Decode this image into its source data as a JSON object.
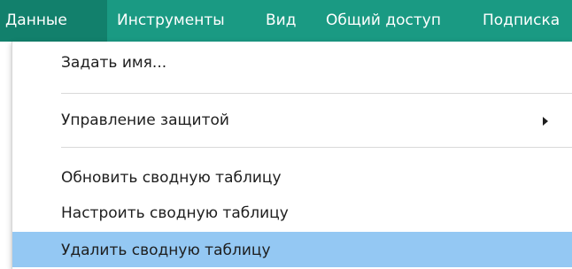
{
  "menubar": {
    "items": [
      {
        "label": "Данные"
      },
      {
        "label": "Инструменты"
      },
      {
        "label": "Вид"
      },
      {
        "label": "Общий доступ"
      },
      {
        "label": "Подписка"
      }
    ]
  },
  "dropdown": {
    "items": [
      {
        "label": "Задать имя..."
      },
      {
        "label": "Управление защитой",
        "has_submenu": true
      },
      {
        "label": "Обновить сводную таблицу"
      },
      {
        "label": "Настроить сводную таблицу"
      },
      {
        "label": "Удалить сводную таблицу",
        "highlighted": true
      }
    ]
  },
  "colors": {
    "menubar_bg": "#1a9a83",
    "menubar_active_bg": "#12806c",
    "highlight_bg": "#94c8f3"
  }
}
